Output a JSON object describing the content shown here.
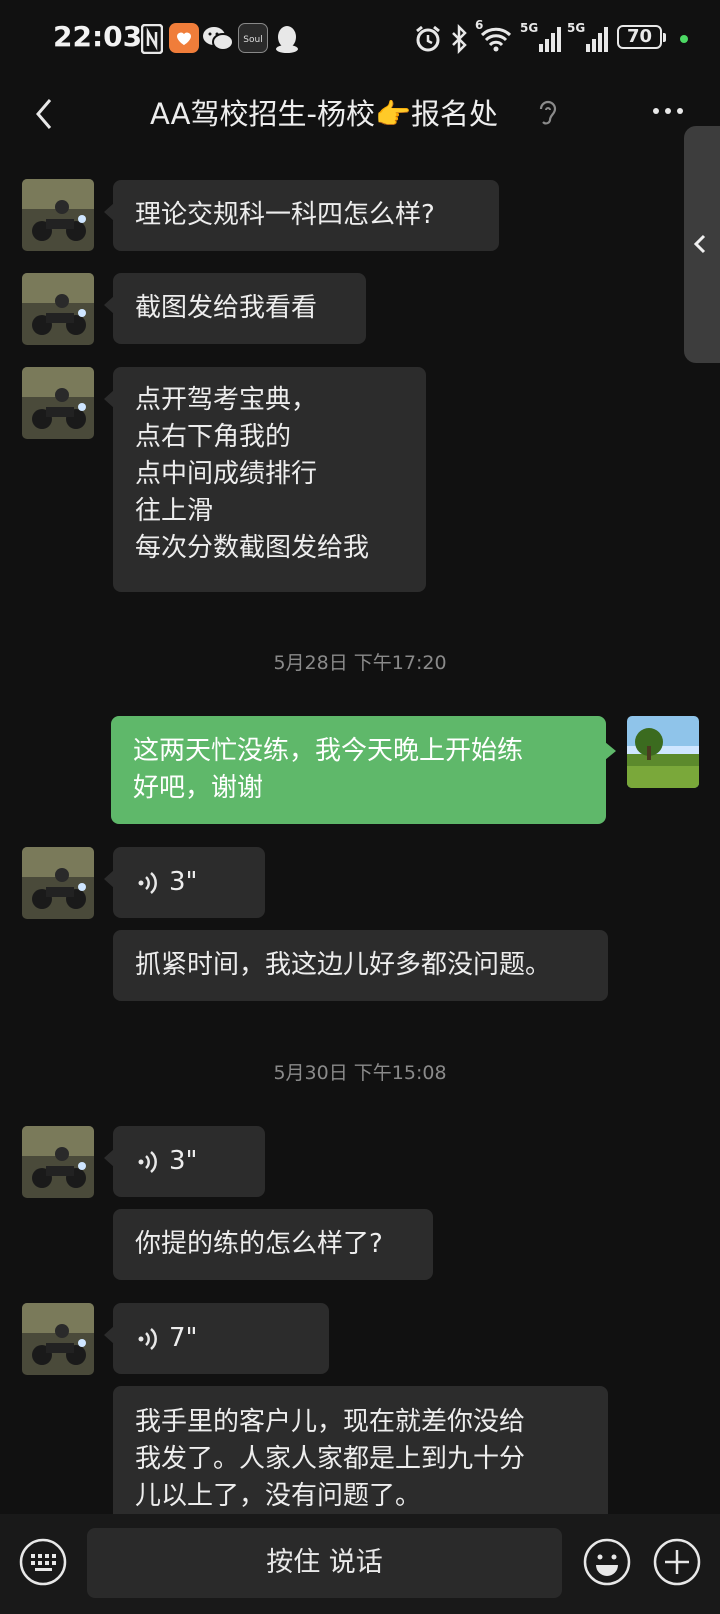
{
  "status_bar": {
    "time": "22:03",
    "battery": "70",
    "net1": "5G",
    "net2": "5G",
    "wifi_label": "6"
  },
  "header": {
    "title": "AA驾校招生-杨校👉报名处"
  },
  "messages": {
    "m1": "理论交规科一科四怎么样?",
    "m2": "截图发给我看看",
    "m3": "点开驾考宝典，\n点右下角我的\n点中间成绩排行\n往上滑\n每次分数截图发给我",
    "ts1": "5月28日 下午17:20",
    "m4": "这两天忙没练，我今天晚上开始练\n好吧，谢谢",
    "v1": "3\"",
    "m5": "抓紧时间，我这边儿好多都没问题。",
    "ts2": "5月30日 下午15:08",
    "v2": "3\"",
    "m6": "你提的练的怎么样了?",
    "v3": "7\"",
    "m7": "我手里的客户儿，现在就差你没给\n我发了。人家人家都是上到九十分\n儿以上了，没有问题了。"
  },
  "input_bar": {
    "talk_label": "按住 说话"
  },
  "colors": {
    "background": "#111111",
    "bubble_in": "#2c2c2c",
    "bubble_out": "#5fb86a",
    "timestamp": "#8a8a8a"
  },
  "icons": [
    "back-icon",
    "ear-icon",
    "more-icon",
    "voice-icon",
    "keyboard-icon",
    "emoji-icon",
    "plus-icon",
    "expand-icon"
  ]
}
